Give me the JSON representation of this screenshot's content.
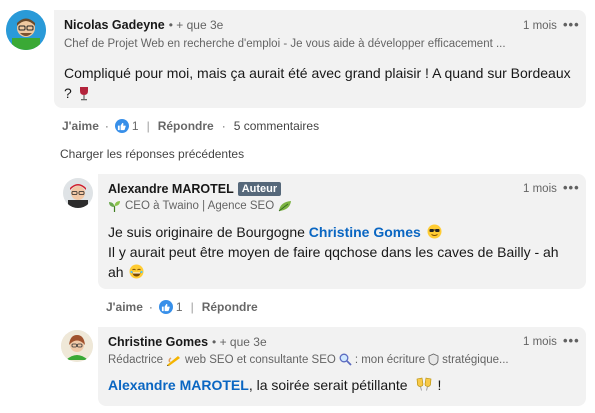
{
  "comment": {
    "name": "Nicolas Gadeyne",
    "degree": "• + que 3e",
    "headline": "Chef de Projet Web en recherche d'emploi - Je vous aide à développer efficacement ...",
    "time": "1 mois",
    "text_line1": "Compliqué pour moi, mais ça aurait été avec grand plaisir ! A quand sur Bordeaux",
    "text_line2": "?",
    "like_label": "J'aime",
    "like_count": "1",
    "reply_label": "Répondre",
    "comments_count": "5 commentaires"
  },
  "load_previous": "Charger les réponses précédentes",
  "reply1": {
    "name": "Alexandre MAROTEL",
    "badge": "Auteur",
    "headline": "CEO à Twaino | Agence SEO",
    "time": "1 mois",
    "text_part1": "Je suis originaire de Bourgogne ",
    "mention": "Christine Gomes",
    "text_line2": "Il y aurait peut être moyen de faire qqchose dans les caves de Bailly - ah",
    "text_line3": "ah",
    "like_label": "J'aime",
    "like_count": "1",
    "reply_label": "Répondre"
  },
  "reply2": {
    "name": "Christine Gomes",
    "degree": "• + que 3e",
    "headline_part1": "Rédactrice",
    "headline_part2": "web SEO et consultante SEO",
    "headline_part3": ": mon écriture",
    "headline_part4": "stratégique...",
    "time": "1 mois",
    "mention": "Alexandre MAROTEL",
    "text": ", la soirée serait pétillante",
    "text_end": "!"
  },
  "colors": {
    "accent": "#0a66c2",
    "like_blue": "#378fe9",
    "card_bg": "#f2f2f2",
    "badge_bg": "#56687a"
  },
  "icons": [
    "like-icon",
    "more-icon",
    "wine-icon",
    "sunglasses-icon",
    "laugh-icon",
    "sprout-icon",
    "leaf-icon",
    "pen-icon",
    "magnifier-icon",
    "shield-icon",
    "cheers-icon"
  ]
}
